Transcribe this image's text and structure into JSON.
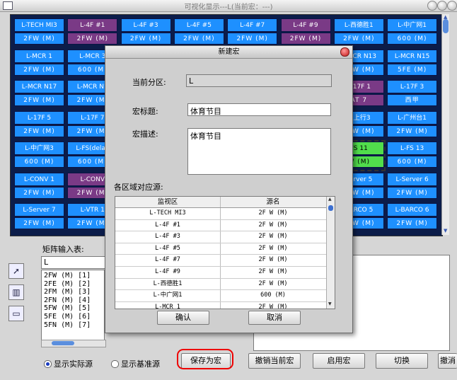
{
  "window": {
    "title": "可视化显示---L(当前宏：---)"
  },
  "grid": {
    "rows": [
      [
        {
          "top": "L-TECH MI3",
          "bot": "2FW (M)",
          "c": "blue"
        },
        {
          "top": "L-4F #1",
          "bot": "2FW (M)",
          "c": "purple"
        },
        {
          "top": "L-4F #3",
          "bot": "2FW (M)",
          "c": "blue"
        },
        {
          "top": "L-4F #5",
          "bot": "2FW (M)",
          "c": "blue"
        },
        {
          "top": "L-4F #7",
          "bot": "2FW (M)",
          "c": "blue"
        },
        {
          "top": "L-4F #9",
          "bot": "2FW (M)",
          "c": "purple"
        },
        {
          "top": "L-西德胜1",
          "bot": "2FW (M)",
          "c": "blue"
        },
        {
          "top": "L-中广网1",
          "bot": "600 (M)",
          "c": "blue"
        }
      ],
      [
        {
          "top": "L-MCR 1",
          "bot": "2FW (M)",
          "c": "blue"
        },
        {
          "top": "L-MCR 3",
          "bot": "600 (M)",
          "c": "blue"
        },
        {
          "top": "",
          "bot": "",
          "c": "blue"
        },
        {
          "top": "",
          "bot": "",
          "c": "blue"
        },
        {
          "top": "",
          "bot": "",
          "c": "blue"
        },
        {
          "top": "",
          "bot": "",
          "c": "blue"
        },
        {
          "top": "L-MCR N13",
          "bot": "2FW (M)",
          "c": "blue"
        },
        {
          "top": "L-MCR N15",
          "bot": "5FE (M)",
          "c": "blue"
        }
      ],
      [
        {
          "top": "L-MCR N17",
          "bot": "2FW (M)",
          "c": "blue"
        },
        {
          "top": "L-MCR N1",
          "bot": "2FW (M)",
          "c": "blue"
        },
        {
          "top": "",
          "bot": "",
          "c": "blue"
        },
        {
          "top": "",
          "bot": "",
          "c": "blue"
        },
        {
          "top": "",
          "bot": "",
          "c": "blue"
        },
        {
          "top": "",
          "bot": "",
          "c": "blue"
        },
        {
          "top": "L-17F 1",
          "bot": "AT 7",
          "c": "purple"
        },
        {
          "top": "L-17F 3",
          "bot": "西甲",
          "c": "blue"
        }
      ],
      [
        {
          "top": "L-17F 5",
          "bot": "2FW (M)",
          "c": "blue"
        },
        {
          "top": "L-17F 7",
          "bot": "2FW (M)",
          "c": "blue"
        },
        {
          "top": "",
          "bot": "",
          "c": "blue"
        },
        {
          "top": "",
          "bot": "",
          "c": "blue"
        },
        {
          "top": "",
          "bot": "",
          "c": "blue"
        },
        {
          "top": "",
          "bot": "",
          "c": "blue"
        },
        {
          "top": "星上行3",
          "bot": "2FW (M)",
          "c": "blue"
        },
        {
          "top": "L-广州台1",
          "bot": "2FW (M)",
          "c": "blue"
        }
      ],
      [
        {
          "top": "L-中广网3",
          "bot": "600 (M)",
          "c": "blue"
        },
        {
          "top": "L-FS(delay",
          "bot": "600 (M)",
          "c": "blue"
        },
        {
          "top": "",
          "bot": "",
          "c": "blue"
        },
        {
          "top": "",
          "bot": "",
          "c": "blue"
        },
        {
          "top": "",
          "bot": "",
          "c": "blue"
        },
        {
          "top": "",
          "bot": "",
          "c": "blue"
        },
        {
          "top": "FS 11",
          "bot": "W (M)",
          "c": "green"
        },
        {
          "top": "L-FS 13",
          "bot": "600 (M)",
          "c": "blue"
        }
      ],
      [
        {
          "top": "L-CONV 1",
          "bot": "2FW (M)",
          "c": "blue"
        },
        {
          "top": "L-CONV",
          "bot": "2FW (M)",
          "c": "purple"
        },
        {
          "top": "",
          "bot": "",
          "c": "blue"
        },
        {
          "top": "",
          "bot": "",
          "c": "blue"
        },
        {
          "top": "",
          "bot": "",
          "c": "blue"
        },
        {
          "top": "",
          "bot": "",
          "c": "blue"
        },
        {
          "top": "Server 5",
          "bot": "2FW (M)",
          "c": "blue"
        },
        {
          "top": "L-Server 6",
          "bot": "2FW (M)",
          "c": "blue"
        }
      ],
      [
        {
          "top": "L-Server 7",
          "bot": "2FW (M)",
          "c": "blue"
        },
        {
          "top": "L-VTR 1",
          "bot": "2FW (M)",
          "c": "blue"
        },
        {
          "top": "",
          "bot": "",
          "c": "blue"
        },
        {
          "top": "",
          "bot": "",
          "c": "blue"
        },
        {
          "top": "",
          "bot": "",
          "c": "blue"
        },
        {
          "top": "",
          "bot": "",
          "c": "blue"
        },
        {
          "top": "BARCO 5",
          "bot": "2FW (M)",
          "c": "blue"
        },
        {
          "top": "L-BARCO 6",
          "bot": "2FW (M)",
          "c": "blue"
        }
      ]
    ]
  },
  "matrix": {
    "label": "矩阵输入表:",
    "input": "L",
    "list": [
      "2FW (M) [1]",
      "2FE (M) [2]",
      "2FM (M) [3]",
      "2FN (M) [4]",
      "5FW (M) [5]",
      "5FE (M) [6]",
      "5FN (M) [7]"
    ]
  },
  "bottom": {
    "radio_actual": "显示实际源",
    "radio_base": "显示基准源",
    "btn_save": "保存为宏",
    "btn_undo": "撤销当前宏",
    "btn_enable": "启用宏",
    "btn_switch": "切换",
    "btn_cancel": "撤消"
  },
  "dialog": {
    "title": "新建宏",
    "zone_label": "当前分区:",
    "zone_value": "L",
    "title_label": "宏标题:",
    "title_value": "体育节目",
    "desc_label": "宏描述:",
    "desc_value": "体育节目",
    "map_label": "各区域对应源:",
    "col_monitor": "监视区",
    "col_source": "源名",
    "rows": [
      [
        "L-TECH MI3",
        "2F W (M)"
      ],
      [
        "L-4F #1",
        "2F W (M)"
      ],
      [
        "L-4F #3",
        "2F W (M)"
      ],
      [
        "L-4F #5",
        "2F W (M)"
      ],
      [
        "L-4F #7",
        "2F W (M)"
      ],
      [
        "L-4F #9",
        "2F W (M)"
      ],
      [
        "L-西德胜1",
        "2F W (M)"
      ],
      [
        "L-中广网1",
        "600 (M)"
      ],
      [
        "L-MCR 1",
        "2F W (M)"
      ]
    ],
    "ok": "确认",
    "cancel": "取消"
  }
}
